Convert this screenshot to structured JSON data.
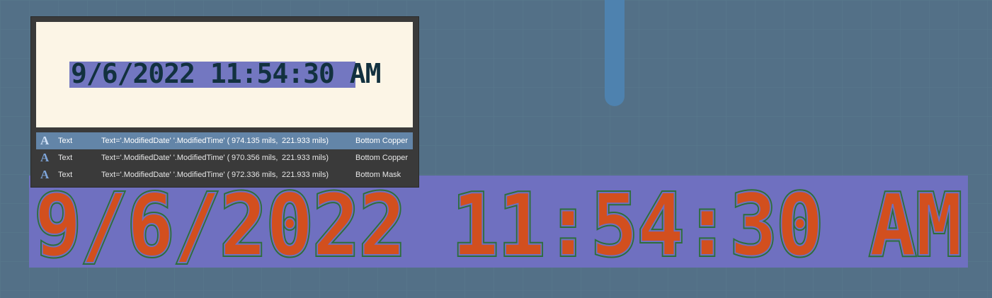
{
  "canvas": {
    "big_text": "9/6/2022 11:54:30 AM",
    "colors": {
      "background": "#537087",
      "text_band": "#6f70c0",
      "text_outline": "#2d6e3a",
      "text_fill": "#d24f1e",
      "track": "#4e82af"
    }
  },
  "popup": {
    "preview_text": "9/6/2022 11:54:30 AM",
    "rows": [
      {
        "icon": "A",
        "type": "Text",
        "expr": "Text='.ModifiedDate' '.ModifiedTime' (",
        "x": "974.135 mils,",
        "y": "221.933 mils)",
        "layer": "Bottom Copper"
      },
      {
        "icon": "A",
        "type": "Text",
        "expr": "Text='.ModifiedDate' '.ModifiedTime' (",
        "x": "970.356 mils,",
        "y": "221.933 mils)",
        "layer": "Bottom Copper"
      },
      {
        "icon": "A",
        "type": "Text",
        "expr": "Text='.ModifiedDate' '.ModifiedTime' (",
        "x": "972.336 mils,",
        "y": "221.933 mils)",
        "layer": "Bottom Mask"
      }
    ]
  }
}
